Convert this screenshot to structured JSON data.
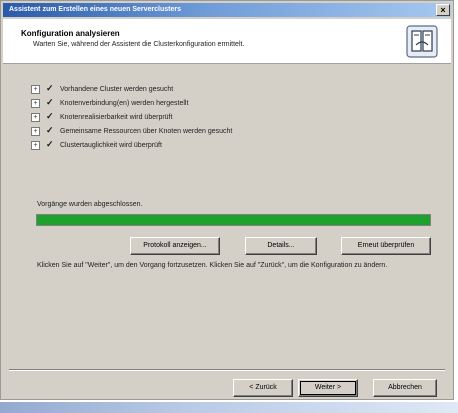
{
  "window": {
    "title": "Assistent zum Erstellen eines neuen Serverclusters",
    "close_glyph": "×"
  },
  "header": {
    "title": "Konfiguration analysieren",
    "subtitle": "Warten Sie, während der Assistent die Clusterkonfiguration ermittelt."
  },
  "steps": [
    {
      "label": "Vorhandene Cluster werden gesucht",
      "expander": "+",
      "check": "✓"
    },
    {
      "label": "Knotenverbindung(en) werden hergestellt",
      "expander": "+",
      "check": "✓"
    },
    {
      "label": "Knotenrealisierbarkeit wird überprüft",
      "expander": "+",
      "check": "✓"
    },
    {
      "label": "Gemeinsame Ressourcen über Knoten werden gesucht",
      "expander": "+",
      "check": "✓"
    },
    {
      "label": "Clustertauglichkeit wird überprüft",
      "expander": "+",
      "check": "✓"
    }
  ],
  "progress": {
    "label": "Vorgänge wurden abgeschlossen.",
    "fraction": 1.0,
    "color": "#1fa12e"
  },
  "actions": {
    "view_log": "Protokoll anzeigen...",
    "details": "Details...",
    "reanalyze": "Erneut überprüfen"
  },
  "hint": "Klicken Sie auf \"Weiter\", um den Vorgang fortzusetzen. Klicken Sie auf \"Zurück\", um die Konfiguration zu ändern.",
  "footer": {
    "back": "< Zurück",
    "next": "Weiter >",
    "cancel": "Abbrechen"
  }
}
